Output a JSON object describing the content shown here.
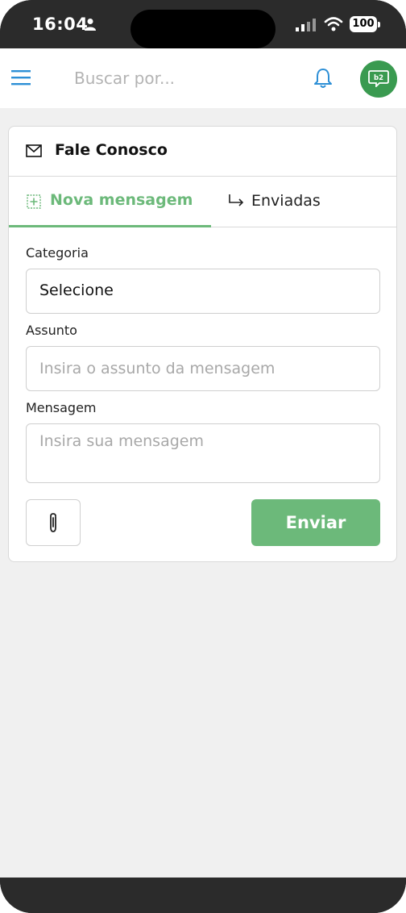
{
  "status_bar": {
    "time": "16:04",
    "battery": "100",
    "icons": [
      "person-icon",
      "signal-icon",
      "wifi-icon",
      "battery-icon"
    ]
  },
  "header": {
    "search_placeholder": "Buscar por...",
    "icons": [
      "menu-icon",
      "bell-icon",
      "avatar-logo-icon"
    ],
    "avatar_text": "b2"
  },
  "card": {
    "title": "Fale Conosco",
    "tabs": [
      {
        "label": "Nova mensagem",
        "active": true,
        "icon": "plus-box-icon"
      },
      {
        "label": "Enviadas",
        "active": false,
        "icon": "reply-arrow-icon"
      }
    ]
  },
  "form": {
    "category_label": "Categoria",
    "category_value": "Selecione",
    "subject_label": "Assunto",
    "subject_placeholder": "Insira o assunto da mensagem",
    "message_label": "Mensagem",
    "message_placeholder": "Insira sua mensagem",
    "send_label": "Enviar",
    "attach_icon": "paperclip-icon"
  },
  "colors": {
    "accent": "#6cb97a",
    "bell": "#2d8fd6",
    "avatar": "#3a9a50",
    "background": "#f0f0f0"
  }
}
